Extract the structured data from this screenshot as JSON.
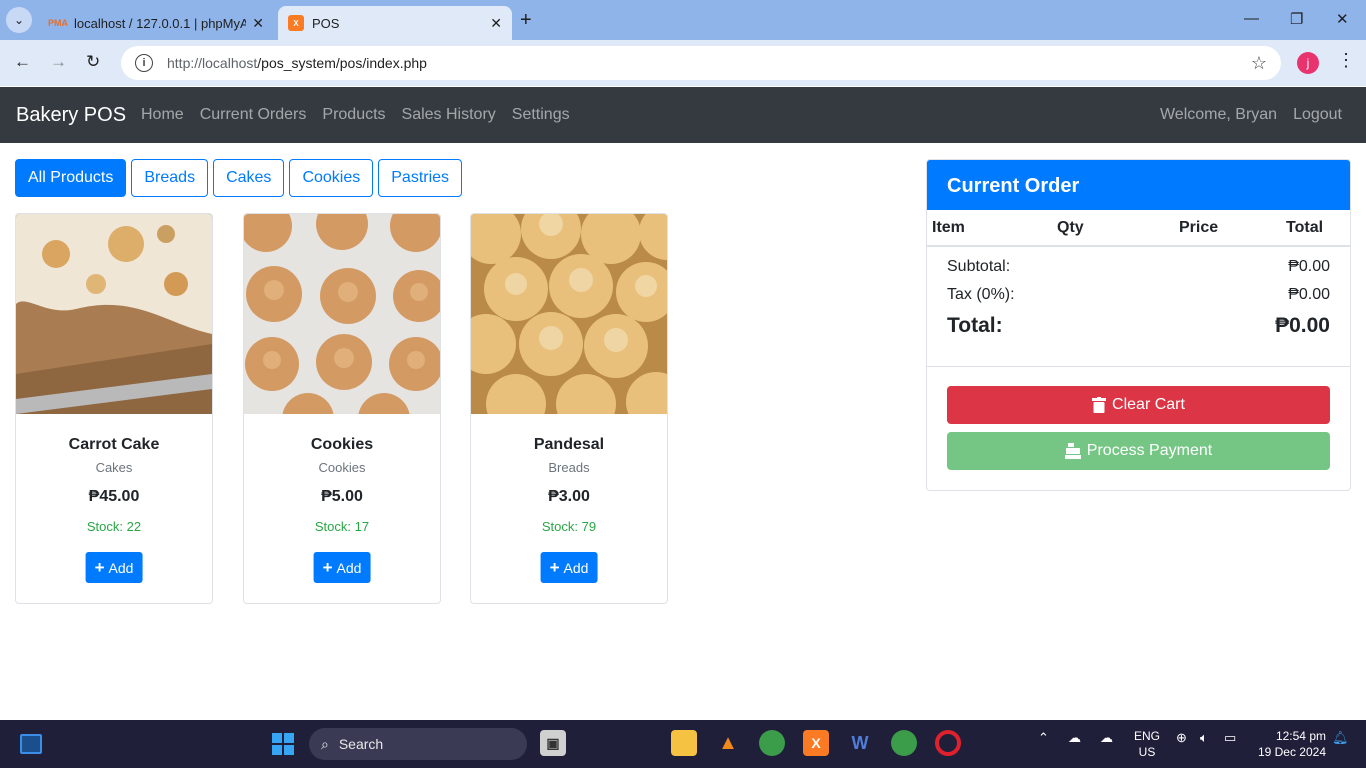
{
  "browser": {
    "tabs": [
      {
        "title": "localhost / 127.0.0.1 | phpMyAd",
        "favicon": "pma-icon"
      },
      {
        "title": "POS",
        "favicon": "xampp-icon"
      }
    ],
    "url_host": "http://localhost",
    "url_path": "/pos_system/pos/index.php",
    "profile_initial": "j"
  },
  "app": {
    "brand": "Bakery POS",
    "nav": [
      "Home",
      "Current Orders",
      "Products",
      "Sales History",
      "Settings"
    ],
    "welcome": "Welcome, Bryan",
    "logout": "Logout"
  },
  "filters": [
    "All Products",
    "Breads",
    "Cakes",
    "Cookies",
    "Pastries"
  ],
  "products": [
    {
      "name": "Carrot Cake",
      "category": "Cakes",
      "price": "₱45.00",
      "stock": "Stock: 22",
      "add": "Add"
    },
    {
      "name": "Cookies",
      "category": "Cookies",
      "price": "₱5.00",
      "stock": "Stock: 17",
      "add": "Add"
    },
    {
      "name": "Pandesal",
      "category": "Breads",
      "price": "₱3.00",
      "stock": "Stock: 79",
      "add": "Add"
    }
  ],
  "order": {
    "title": "Current Order",
    "columns": [
      "Item",
      "Qty",
      "Price",
      "Total"
    ],
    "subtotal_label": "Subtotal:",
    "subtotal": "₱0.00",
    "tax_label": "Tax (0%):",
    "tax": "₱0.00",
    "total_label": "Total:",
    "total": "₱0.00",
    "clear_label": "Clear Cart",
    "pay_label": "Process Payment"
  },
  "taskbar": {
    "search": "Search",
    "lang_top": "ENG",
    "lang_bottom": "US",
    "time": "12:54 pm",
    "date": "19 Dec 2024"
  }
}
